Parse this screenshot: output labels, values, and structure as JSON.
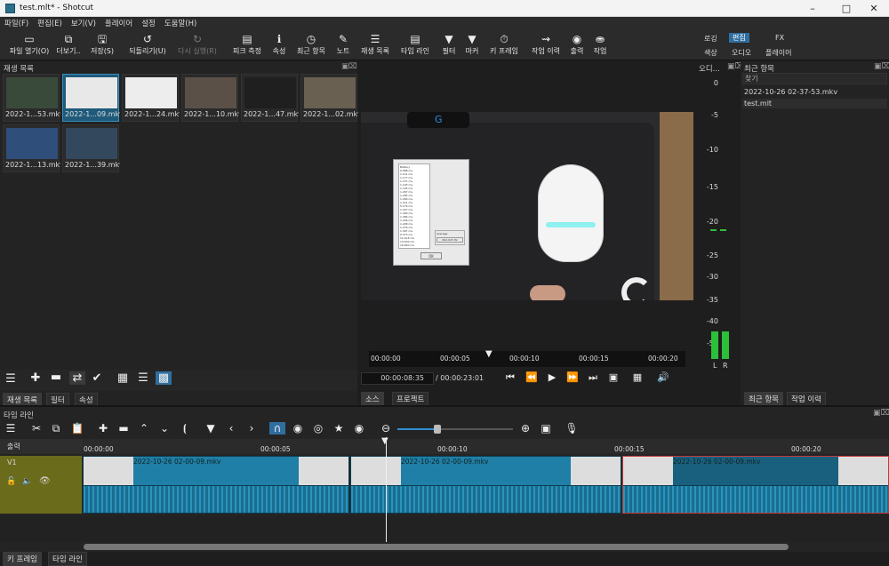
{
  "window": {
    "title": "test.mlt* - Shotcut"
  },
  "menu": [
    "파일(F)",
    "편집(E)",
    "보기(V)",
    "플레이어",
    "설정",
    "도움말(H)"
  ],
  "toolbar": {
    "open": "파일 열기(O)",
    "more": "더보기..",
    "save": "저장(S)",
    "undo": "되돌리기(U)",
    "redo": "다시 실행(R)",
    "peak": "피크 측정",
    "props": "속성",
    "recent": "최근 항목",
    "notes": "노트",
    "playlist": "재생 목록",
    "timeline": "타임 라인",
    "filters": "필터",
    "markers": "마커",
    "keyframes": "키 프레임",
    "history": "작업 이력",
    "export": "출력",
    "jobs": "작업"
  },
  "workspace": {
    "row1": [
      "로깅",
      "편집",
      "FX"
    ],
    "row2": [
      "색상",
      "오디오",
      "플레이어"
    ],
    "active": "편집"
  },
  "playlist": {
    "title": "재생 목록",
    "items": [
      "2022-1...53.mkv",
      "2022-1...09.mkv",
      "2022-1...24.mkv",
      "2022-1...10.mkv",
      "2022-1...47.mkv",
      "2022-1...02.mkv",
      "2022-1...13.mkv",
      "2022-1...39.mkv"
    ],
    "selected_index": 1,
    "tabs": [
      "재생 목록",
      "필터",
      "속성"
    ]
  },
  "player": {
    "ruler": [
      "00:00:00",
      "00:00:05",
      "00:00:10",
      "00:00:15",
      "00:00:20"
    ],
    "position": "00:00:08:35",
    "duration": "/ 00:00:23:01",
    "tabs": [
      "소스",
      "프로젝트"
    ],
    "dialog": {
      "list_title": "Battery",
      "list_values": [
        "0.988 ms",
        "1.121 ms",
        "1.177 ms",
        "1.157 ms",
        "1.193 ms",
        "1.195 ms",
        "1.267 ms",
        "1.265 ms",
        "1.260 ms",
        "1.241 ms",
        "5.179 ms",
        "1.247 ms",
        "1.269 ms",
        "1.289 ms",
        "1.246 ms",
        "1.248 ms",
        "1.276 ms",
        "1.367 ms",
        "9.373 ms",
        "12.416 ms",
        "14.500 ms",
        "16.800 ms"
      ],
      "avg_label": "Average",
      "avg_value": "992.015 Hz",
      "ok": "OK"
    }
  },
  "meter": {
    "title": "오디...",
    "ticks": [
      "0",
      "-5",
      "-10",
      "-15",
      "-20",
      "-25",
      "-30",
      "-35",
      "-40",
      "-50"
    ],
    "channels": [
      "L",
      "R"
    ]
  },
  "recent": {
    "title": "최근 항목",
    "search_placeholder": "찾기",
    "items": [
      "2022-10-26 02-37-53.mkv",
      "test.mlt"
    ],
    "tabs": [
      "최근 항목",
      "작업 이력"
    ]
  },
  "timeline": {
    "title": "타임 라인",
    "output": "출력",
    "ruler": [
      "00:00:00",
      "00:00:05",
      "00:00:10",
      "00:00:15",
      "00:00:20"
    ],
    "track": "V1",
    "clips": [
      "2022-10-26 02-00-09.mkv",
      "2022-10-26 02-00-09.mkv",
      "2022-10-26 02-00-09.mkv"
    ]
  },
  "bottom_tabs": [
    "키 프레임",
    "타임 라인"
  ],
  "colors": {
    "accent": "#2f6fa0",
    "clip": "#1f7fa6",
    "track_header": "#6b6b1c",
    "meter": "#2cbf3a"
  }
}
